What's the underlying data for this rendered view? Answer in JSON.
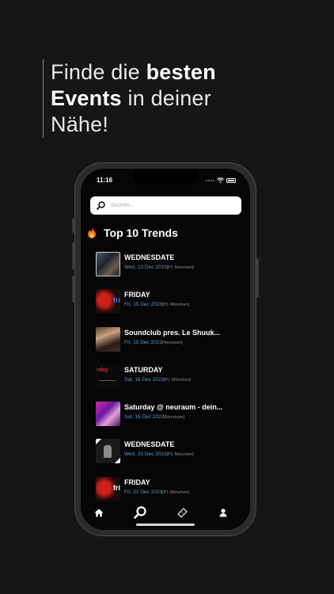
{
  "headline": {
    "line1_light": "Finde die ",
    "line1_bold": "besten",
    "line2_bold": "Events",
    "line2_light": " in deiner",
    "line3_light": "Nähe!"
  },
  "status_bar": {
    "time": "11:16"
  },
  "search": {
    "placeholder": "Suchen..."
  },
  "section": {
    "icon": "fire-icon",
    "title": "Top 10 Trends"
  },
  "events": [
    {
      "name": "WEDNESDATE",
      "date": "Wed, 13 Dec 2023",
      "venue": "[P1 München]",
      "thumb": "photo"
    },
    {
      "name": "FRIDAY",
      "date": "Fri, 15 Dec 2023",
      "venue": "[P1 München]",
      "thumb": "friday-red"
    },
    {
      "name": "Soundclub pres. Le Shuuk...",
      "date": "Fri, 15 Dec 2023",
      "venue": "[Neuraum]",
      "thumb": "photo-warm"
    },
    {
      "name": "SATURDAY",
      "date": "Sat, 16 Dec 2023",
      "venue": "[P1 München]",
      "thumb": "saturday-text"
    },
    {
      "name": "Saturday @ neuraum -  dein...",
      "date": "Sat, 16 Dec 2023",
      "venue": "[Neuraum]",
      "thumb": "photo-pink"
    },
    {
      "name": "WEDNESDATE",
      "date": "Wed, 20 Dec 2023",
      "venue": "[P1 München]",
      "thumb": "photo-frame"
    },
    {
      "name": "FRIDAY",
      "date": "Fri, 22 Dec 2023",
      "venue": "[P1 München]",
      "thumb": "friday-red"
    }
  ],
  "tabbar": [
    {
      "icon": "home-icon"
    },
    {
      "icon": "search-icon"
    },
    {
      "icon": "ticket-icon"
    },
    {
      "icon": "profile-icon"
    }
  ],
  "colors": {
    "accent": "#4f9cd8",
    "background": "#161616",
    "screen": "#060606"
  }
}
